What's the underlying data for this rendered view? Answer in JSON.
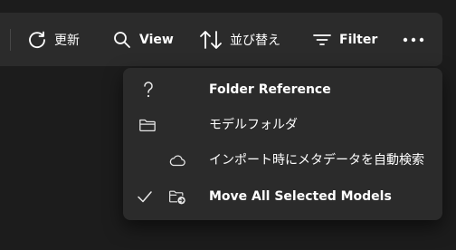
{
  "toolbar": {
    "refresh_label": "更新",
    "view_label": "View",
    "sort_label": "並び替え",
    "filter_label": "Filter",
    "more_icon": "more-horizontal-icon"
  },
  "menu": {
    "items": [
      {
        "label": "Folder Reference",
        "icon": "question-mark-icon",
        "checked": false
      },
      {
        "label": "モデルフォルダ",
        "icon": "folder-icon",
        "checked": false
      },
      {
        "label": "インポート時にメタデータを自動検索",
        "icon": "cloud-icon",
        "checked": false
      },
      {
        "label": "Move All Selected Models",
        "icon": "folder-move-icon",
        "checked": true
      }
    ]
  },
  "colors": {
    "background": "#1c1c1c",
    "surface": "#2b2b2b",
    "text": "#ffffff"
  }
}
